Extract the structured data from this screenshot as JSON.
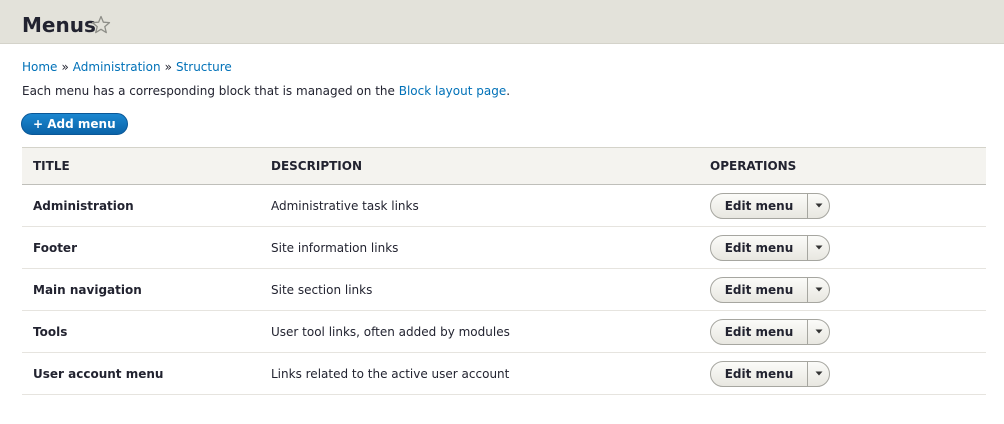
{
  "page": {
    "title": "Menus"
  },
  "breadcrumb": {
    "items": [
      "Home",
      "Administration",
      "Structure"
    ],
    "separator": "»"
  },
  "description": {
    "text": "Each menu has a corresponding block that is managed on the ",
    "link": "Block layout page",
    "suffix": "."
  },
  "actions": {
    "add_label": "+ Add menu"
  },
  "table": {
    "headers": [
      "TITLE",
      "DESCRIPTION",
      "OPERATIONS"
    ],
    "rows": [
      {
        "title": "Administration",
        "description": "Administrative task links",
        "operation": "Edit menu"
      },
      {
        "title": "Footer",
        "description": "Site information links",
        "operation": "Edit menu"
      },
      {
        "title": "Main navigation",
        "description": "Site section links",
        "operation": "Edit menu"
      },
      {
        "title": "Tools",
        "description": "User tool links, often added by modules",
        "operation": "Edit menu"
      },
      {
        "title": "User account menu",
        "description": "Links related to the active user account",
        "operation": "Edit menu"
      }
    ]
  },
  "icons": {
    "favorite": "star-outline-icon",
    "dropdown": "caret-down-icon"
  },
  "colors": {
    "header_bg": "#e3e2da",
    "link": "#0071b8",
    "primary_button": "#0a63a8"
  }
}
